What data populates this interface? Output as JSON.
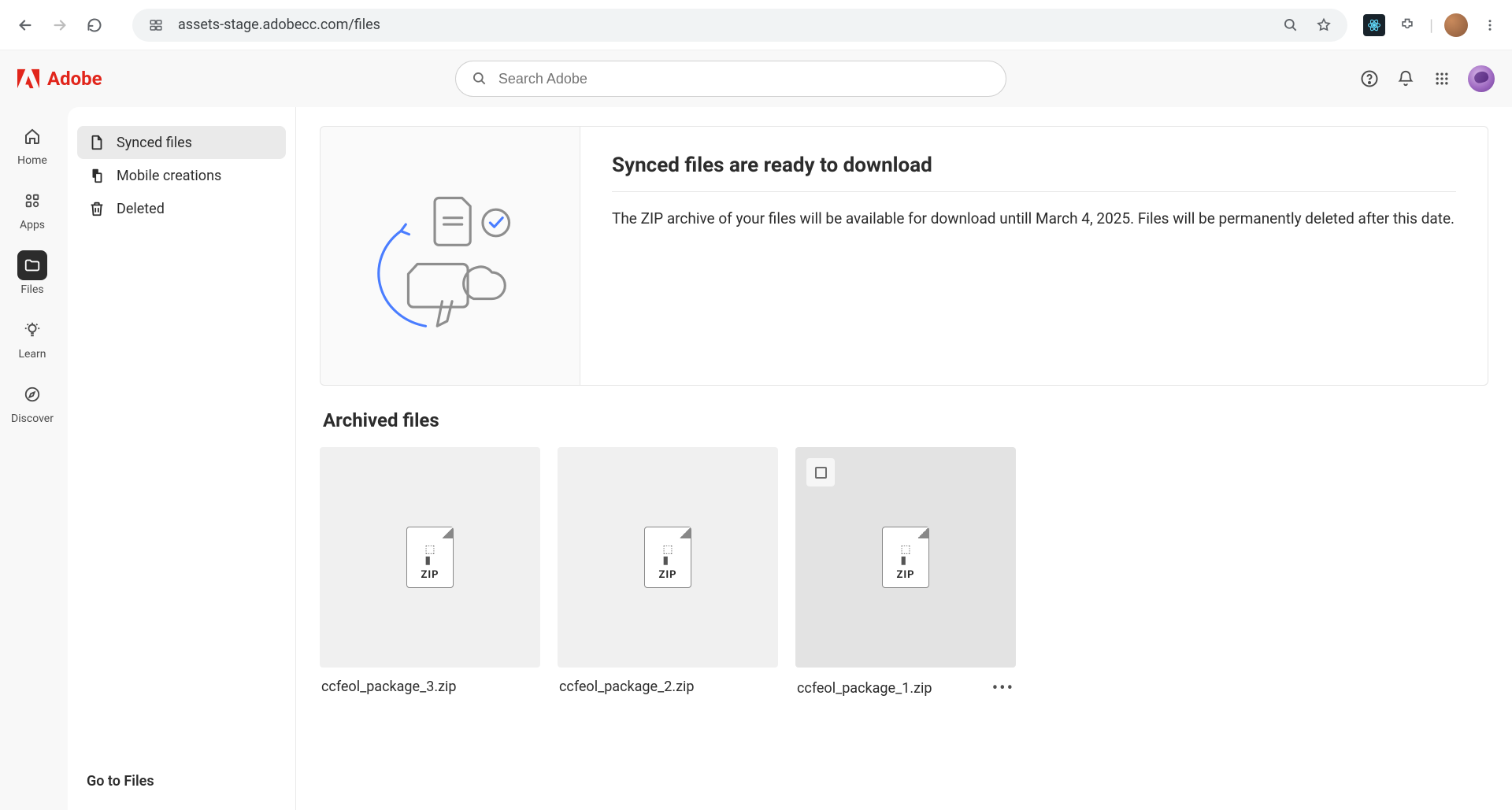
{
  "browser": {
    "url": "assets-stage.adobecc.com/files"
  },
  "header": {
    "brand": "Adobe",
    "search_placeholder": "Search Adobe"
  },
  "vnav": {
    "items": [
      {
        "label": "Home"
      },
      {
        "label": "Apps"
      },
      {
        "label": "Files"
      },
      {
        "label": "Learn"
      },
      {
        "label": "Discover"
      }
    ],
    "active_index": 2
  },
  "side": {
    "items": [
      {
        "label": "Synced files"
      },
      {
        "label": "Mobile creations"
      },
      {
        "label": "Deleted"
      }
    ],
    "selected_index": 0,
    "go_files": "Go to Files"
  },
  "banner": {
    "title": "Synced files are ready to download",
    "desc": "The ZIP archive of your files will be available for download untill March 4, 2025. Files will be permanently deleted after this date."
  },
  "archived": {
    "title": "Archived files",
    "files": [
      {
        "name": "ccfeol_package_3.zip",
        "type": "ZIP"
      },
      {
        "name": "ccfeol_package_2.zip",
        "type": "ZIP"
      },
      {
        "name": "ccfeol_package_1.zip",
        "type": "ZIP"
      }
    ],
    "hovered_index": 2
  }
}
